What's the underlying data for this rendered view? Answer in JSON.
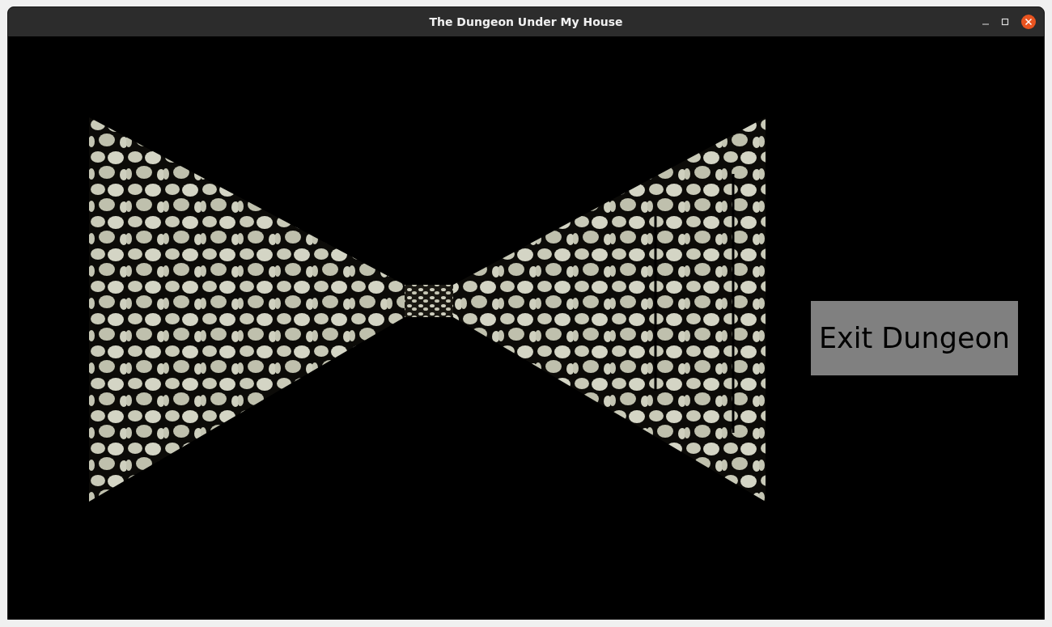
{
  "window": {
    "title": "The Dungeon Under My House"
  },
  "exit_button": {
    "label": "Exit Dungeon"
  }
}
